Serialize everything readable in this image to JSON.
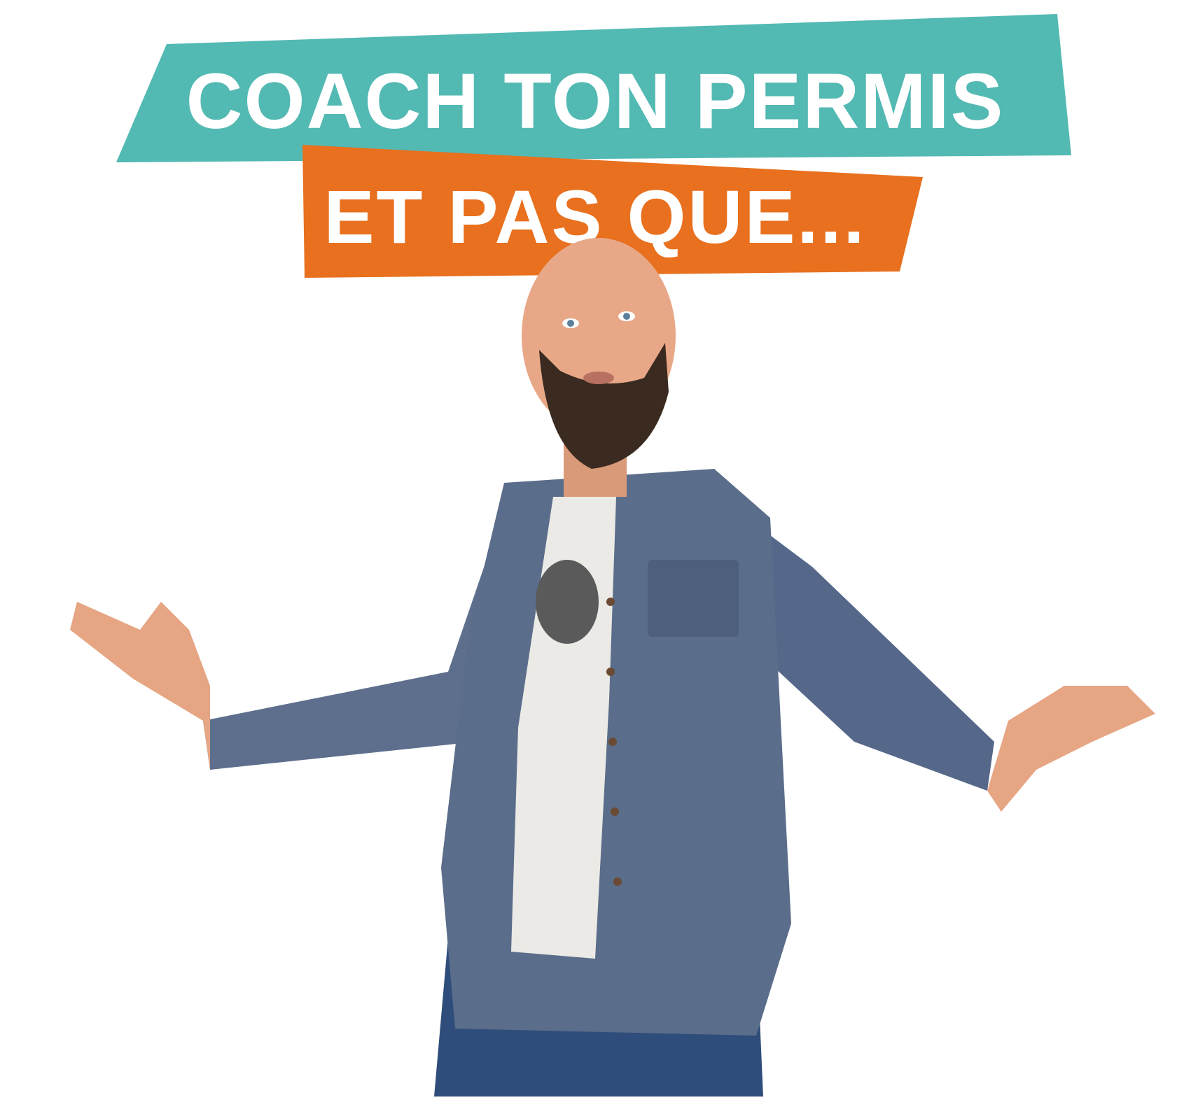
{
  "headline": {
    "line1": "COACH TON PERMIS",
    "line2": "ET PAS QUE..."
  },
  "colors": {
    "teal_banner": "#53b9b3",
    "orange_banner": "#e8701e",
    "text": "#ffffff",
    "shirt": "#5a6d8a",
    "skin": "#e8a888",
    "beard": "#3a2a20",
    "jeans": "#2f4d7a"
  },
  "icons": [
    "person-photo"
  ]
}
